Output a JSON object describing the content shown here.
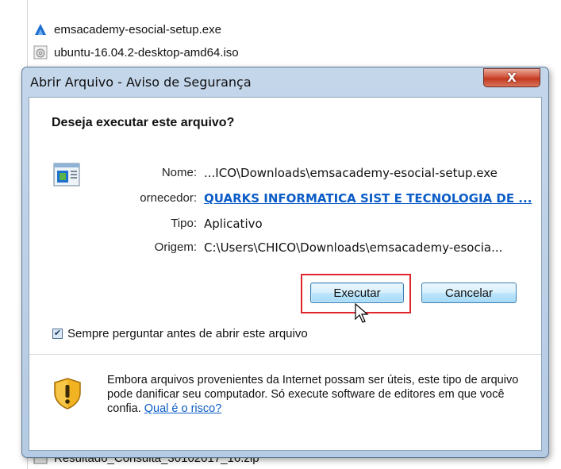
{
  "background": {
    "files": [
      {
        "name": "emsacademy-esocial-setup.exe",
        "icon": "arrow-installer-icon"
      },
      {
        "name": "ubuntu-16.04.2-desktop-amd64.iso",
        "icon": "disc-image-icon"
      },
      {
        "name": "Resultado_Consulta_30102017_16.zip",
        "icon": "zip-file-icon"
      }
    ]
  },
  "dialog": {
    "title": "Abrir Arquivo - Aviso de Segurança",
    "close_label": "X",
    "question": "Deseja executar este arquivo?",
    "fields": {
      "name_label": "Nome:",
      "name_value": "...ICO\\Downloads\\emsacademy-esocial-setup.exe",
      "publisher_label": "ornecedor:",
      "publisher_value": "QUARKS INFORMATICA SIST E TECNOLOGIA DE ...",
      "type_label": "Tipo:",
      "type_value": "Aplicativo",
      "origin_label": "Origem:",
      "origin_value": "C:\\Users\\CHICO\\Downloads\\emsacademy-esocia..."
    },
    "buttons": {
      "run": "Executar",
      "cancel": "Cancelar"
    },
    "checkbox": {
      "label": "Sempre perguntar antes de abrir este arquivo",
      "checked": true
    },
    "warning": {
      "text": "Embora arquivos provenientes da Internet possam ser úteis, este tipo de arquivo pode danificar seu computador. Só execute software de editores em que você confia.",
      "link": "Qual é o risco?"
    }
  },
  "colors": {
    "highlight": "#e0262c",
    "link": "#0b5cc7",
    "frame": "#b5cbe3"
  }
}
